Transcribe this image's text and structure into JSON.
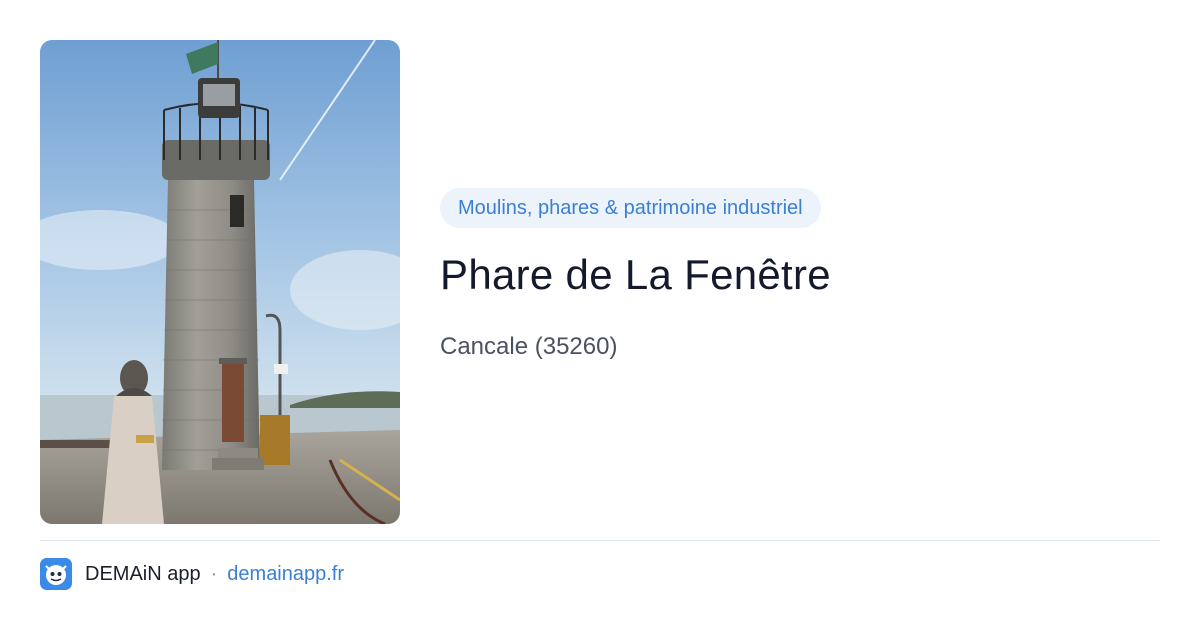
{
  "photo": {
    "subject": "lighthouse-photo"
  },
  "category": {
    "label": "Moulins, phares & patrimoine industriel"
  },
  "place": {
    "title": "Phare de La Fenêtre",
    "location": "Cancale (35260)"
  },
  "footer": {
    "app_name": "DEMAiN app",
    "separator": "·",
    "domain": "demainapp.fr"
  },
  "colors": {
    "accent": "#3b7fd4",
    "badge_bg": "#edf3fb",
    "title": "#141a2b",
    "muted": "#4a5160"
  }
}
